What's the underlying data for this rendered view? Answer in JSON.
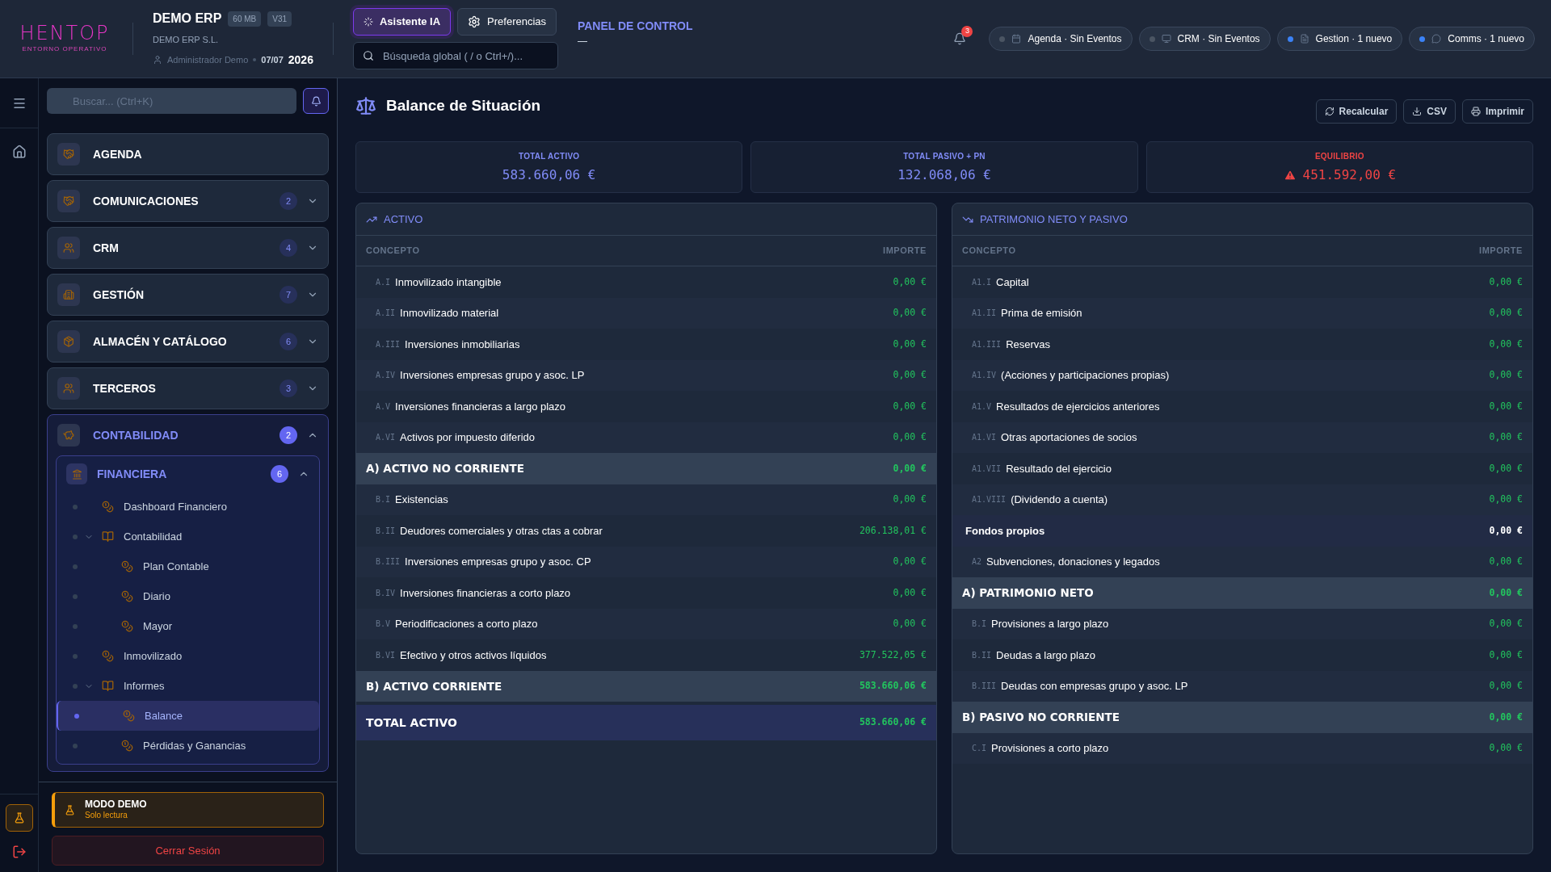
{
  "header": {
    "logo": {
      "name": "HENTOP",
      "tagline": "ENTORNO OPERATIVO"
    },
    "company": {
      "title": "DEMO ERP",
      "badges": [
        "60 MB",
        "V31"
      ],
      "legal_name": "DEMO ERP S.L.",
      "user": "Administrador Demo",
      "date": "07/07",
      "year": "2026"
    },
    "actions": [
      {
        "label": "Asistente IA",
        "selected": true
      },
      {
        "label": "Preferencias",
        "selected": false
      }
    ],
    "search": {
      "placeholder": "Búsqueda global ( / o Ctrl+/)..."
    },
    "section_title": "PANEL DE CONTROL",
    "notifications": {
      "count": "3"
    },
    "status_pills": [
      {
        "label": "Agenda · Sin Eventos",
        "color": "#4b5563"
      },
      {
        "label": "CRM · Sin Eventos",
        "color": "#4b5563"
      },
      {
        "label": "Gestion · 1 nuevo",
        "color": "#3b82f6"
      },
      {
        "label": "Comms · 1 nuevo",
        "color": "#3b82f6"
      }
    ]
  },
  "sidebar": {
    "search": {
      "placeholder": "Buscar... (Ctrl+K)"
    },
    "modules": [
      {
        "label": "AGENDA"
      },
      {
        "label": "COMUNICACIONES",
        "badge": "2",
        "expanded": false
      },
      {
        "label": "CRM",
        "badge": "4",
        "expanded": false
      },
      {
        "label": "GESTIÓN",
        "badge": "7",
        "expanded": false
      },
      {
        "label": "ALMACÉN Y CATÁLOGO",
        "badge": "6",
        "expanded": false
      },
      {
        "label": "TERCEROS",
        "badge": "3",
        "expanded": false
      },
      {
        "label": "CONTABILIDAD",
        "badge": "2",
        "expanded": true,
        "children": [
          {
            "label": "FINANCIERA",
            "badge": "6",
            "expanded": true,
            "children": [
              {
                "label": "Dashboard Financiero",
                "selected": false
              },
              {
                "label": "Contabilidad",
                "selected": false,
                "expanded": true,
                "children": [
                  {
                    "label": "Plan Contable",
                    "selected": false
                  },
                  {
                    "label": "Diario",
                    "selected": false
                  },
                  {
                    "label": "Mayor",
                    "selected": false
                  }
                ]
              },
              {
                "label": "Inmovilizado",
                "selected": false
              },
              {
                "label": "Informes",
                "selected": false,
                "expanded": true,
                "children": [
                  {
                    "label": "Balance",
                    "selected": true
                  },
                  {
                    "label": "Pérdidas y Ganancias",
                    "selected": false
                  }
                ]
              }
            ]
          }
        ]
      }
    ],
    "demo_notice": {
      "title": "MODO DEMO",
      "subtitle": "Solo lectura"
    },
    "logout": "Cerrar Sesión"
  },
  "page": {
    "title": "Balance de Situación",
    "actions": [
      "Recalcular",
      "CSV",
      "Imprimir"
    ],
    "summary": [
      {
        "label": "TOTAL ACTIVO",
        "value": "583.660,06 €",
        "color": "#818cf8",
        "warning": false
      },
      {
        "label": "TOTAL PASIVO + PN",
        "value": "132.068,06 €",
        "color": "#818cf8",
        "warning": false
      },
      {
        "label": "EQUILIBRIO",
        "value": "451.592,00 €",
        "color": "#ef4444",
        "warning": true
      }
    ],
    "panels": [
      {
        "title": "ACTIVO",
        "kind": "rising",
        "columns": [
          "CONCEPTO",
          "IMPORTE"
        ],
        "rows": [
          {
            "kind": "item",
            "code": "A.I",
            "concept": "Inmovilizado intangible",
            "amount": "0,00 €"
          },
          {
            "kind": "item",
            "code": "A.II",
            "concept": "Inmovilizado material",
            "amount": "0,00 €"
          },
          {
            "kind": "item",
            "code": "A.III",
            "concept": "Inversiones inmobiliarias",
            "amount": "0,00 €"
          },
          {
            "kind": "item",
            "code": "A.IV",
            "concept": "Inversiones empresas grupo y asoc. LP",
            "amount": "0,00 €"
          },
          {
            "kind": "item",
            "code": "A.V",
            "concept": "Inversiones financieras a largo plazo",
            "amount": "0,00 €"
          },
          {
            "kind": "item",
            "code": "A.VI",
            "concept": "Activos por impuesto diferido",
            "amount": "0,00 €"
          },
          {
            "kind": "section",
            "concept": "A) ACTIVO NO CORRIENTE",
            "amount": "0,00 €"
          },
          {
            "kind": "item",
            "code": "B.I",
            "concept": "Existencias",
            "amount": "0,00 €"
          },
          {
            "kind": "item",
            "code": "B.II",
            "concept": "Deudores comerciales y otras ctas a cobrar",
            "amount": "206.138,01 €"
          },
          {
            "kind": "item",
            "code": "B.III",
            "concept": "Inversiones empresas grupo y asoc. CP",
            "amount": "0,00 €"
          },
          {
            "kind": "item",
            "code": "B.IV",
            "concept": "Inversiones financieras a corto plazo",
            "amount": "0,00 €"
          },
          {
            "kind": "item",
            "code": "B.V",
            "concept": "Periodificaciones a corto plazo",
            "amount": "0,00 €"
          },
          {
            "kind": "item",
            "code": "B.VI",
            "concept": "Efectivo y otros activos líquidos",
            "amount": "377.522,05 €"
          },
          {
            "kind": "section",
            "concept": "B) ACTIVO CORRIENTE",
            "amount": "583.660,06 €"
          },
          {
            "kind": "total",
            "concept": "TOTAL ACTIVO",
            "amount": "583.660,06 €"
          }
        ]
      },
      {
        "title": "PATRIMONIO NETO Y PASIVO",
        "kind": "falling",
        "columns": [
          "CONCEPTO",
          "IMPORTE"
        ],
        "rows": [
          {
            "kind": "item",
            "code": "A1.I",
            "concept": "Capital",
            "amount": "0,00 €"
          },
          {
            "kind": "item",
            "code": "A1.II",
            "concept": "Prima de emisión",
            "amount": "0,00 €"
          },
          {
            "kind": "item",
            "code": "A1.III",
            "concept": "Reservas",
            "amount": "0,00 €"
          },
          {
            "kind": "item",
            "code": "A1.IV",
            "concept": "(Acciones y participaciones propias)",
            "amount": "0,00 €"
          },
          {
            "kind": "item",
            "code": "A1.V",
            "concept": "Resultados de ejercicios anteriores",
            "amount": "0,00 €"
          },
          {
            "kind": "item",
            "code": "A1.VI",
            "concept": "Otras aportaciones de socios",
            "amount": "0,00 €"
          },
          {
            "kind": "item",
            "code": "A1.VII",
            "concept": "Resultado del ejercicio",
            "amount": "0,00 €"
          },
          {
            "kind": "item",
            "code": "A1.VIII",
            "concept": "(Dividendo a cuenta)",
            "amount": "0,00 €"
          },
          {
            "kind": "subtotal",
            "concept": "Fondos propios",
            "amount": "0,00 €"
          },
          {
            "kind": "item",
            "code": "A2",
            "concept": "Subvenciones, donaciones y legados",
            "amount": "0,00 €"
          },
          {
            "kind": "section",
            "concept": "A) PATRIMONIO NETO",
            "amount": "0,00 €"
          },
          {
            "kind": "item",
            "code": "B.I",
            "concept": "Provisiones a largo plazo",
            "amount": "0,00 €"
          },
          {
            "kind": "item",
            "code": "B.II",
            "concept": "Deudas a largo plazo",
            "amount": "0,00 €"
          },
          {
            "kind": "item",
            "code": "B.III",
            "concept": "Deudas con empresas grupo y asoc. LP",
            "amount": "0,00 €"
          },
          {
            "kind": "section",
            "concept": "B) PASIVO NO CORRIENTE",
            "amount": "0,00 €"
          },
          {
            "kind": "item",
            "code": "C.I",
            "concept": "Provisiones a corto plazo",
            "amount": "0,00 €"
          }
        ]
      }
    ]
  }
}
